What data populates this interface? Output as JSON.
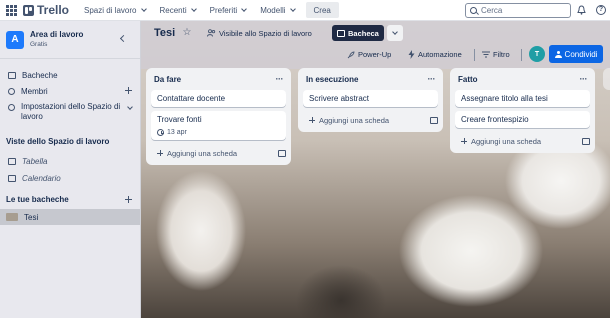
{
  "topbar": {
    "app_name": "Trello",
    "menus": [
      "Spazi di lavoro",
      "Recenti",
      "Preferiti",
      "Modelli"
    ],
    "create_label": "Crea",
    "search_placeholder": "Cerca",
    "help_glyph": "?"
  },
  "sidebar": {
    "workspace_name": "Area di lavoro",
    "workspace_plan": "Gratis",
    "workspace_initial": "A",
    "nav": [
      "Bacheche",
      "Membri",
      "Impostazioni dello Spazio di lavoro"
    ],
    "views_title": "Viste dello Spazio di lavoro",
    "views": [
      "Tabella",
      "Calendario"
    ],
    "boards_title": "Le tue bacheche",
    "boards": [
      "Tesi"
    ]
  },
  "board": {
    "title": "Tesi",
    "star_glyph": "☆",
    "visibility": "Visibile allo Spazio di lavoro",
    "view_label": "Bacheca",
    "power_up": "Power-Up",
    "automation": "Automazione",
    "filter": "Filtro",
    "avatar_initial": "T",
    "share": "Condividi",
    "list_menu_glyph": "···"
  },
  "lists": [
    {
      "title": "Da fare",
      "cards": [
        {
          "title": "Contattare docente"
        },
        {
          "title": "Trovare fonti",
          "due": "13 apr"
        }
      ],
      "add_label": "Aggiungi una scheda"
    },
    {
      "title": "In esecuzione",
      "cards": [
        {
          "title": "Scrivere abstract"
        }
      ],
      "add_label": "Aggiungi una scheda"
    },
    {
      "title": "Fatto",
      "cards": [
        {
          "title": "Assegnare titolo alla tesi"
        },
        {
          "title": "Creare frontespizio"
        }
      ],
      "add_label": "Aggiungi una scheda"
    }
  ],
  "colors": {
    "brand_blue": "#0c66e4",
    "board_button": "#1f2a44",
    "workspace_avatar": "#1d7afc",
    "user_avatar": "#1f9ea5"
  },
  "icons": [
    "apps-grid-icon",
    "trello-logo-icon",
    "search-icon",
    "bell-icon",
    "help-icon",
    "collapse-sidebar-icon",
    "boards-icon",
    "members-icon",
    "settings-icon",
    "table-icon",
    "calendar-icon",
    "star-icon",
    "visibility-icon",
    "board-view-icon",
    "rocket-icon",
    "lightning-icon",
    "filter-icon",
    "add-person-icon",
    "clock-icon",
    "template-icon"
  ]
}
